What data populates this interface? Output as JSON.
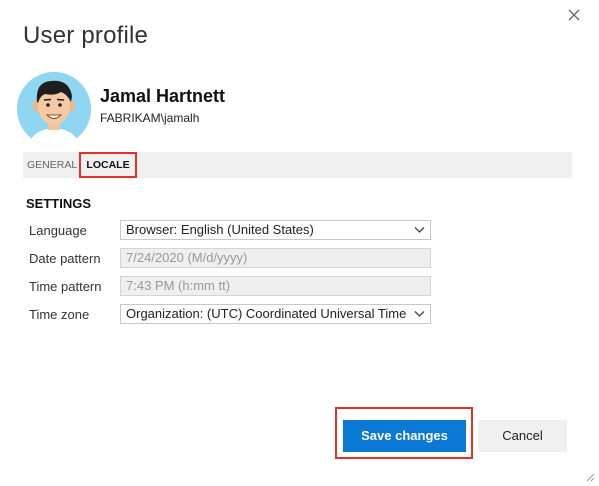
{
  "dialog": {
    "title": "User profile",
    "close_icon": "close-icon"
  },
  "user": {
    "name": "Jamal Hartnett",
    "account": "FABRIKAM\\jamalh",
    "avatar_icon": "avatar-illustration"
  },
  "tabs": [
    {
      "label": "GENERAL",
      "selected": false
    },
    {
      "label": "LOCALE",
      "selected": true
    }
  ],
  "settings": {
    "heading": "SETTINGS",
    "fields": [
      {
        "label": "Language",
        "value": "Browser: English (United States)",
        "type": "select"
      },
      {
        "label": "Date pattern",
        "value": "7/24/2020 (M/d/yyyy)",
        "type": "readonly"
      },
      {
        "label": "Time pattern",
        "value": "7:43 PM (h:mm tt)",
        "type": "readonly"
      },
      {
        "label": "Time zone",
        "value": "Organization: (UTC) Coordinated Universal Time",
        "type": "select"
      }
    ]
  },
  "actions": {
    "save_label": "Save changes",
    "cancel_label": "Cancel"
  },
  "colors": {
    "primary": "#0a78d4",
    "highlight": "#e0322a",
    "tab_bar": "#f0f0f0",
    "avatar_bg": "#8fd6f3"
  }
}
